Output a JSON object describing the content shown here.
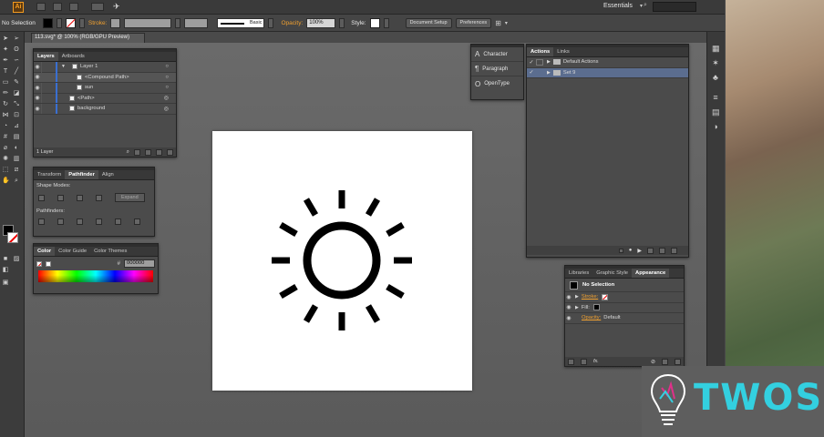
{
  "menubar": {
    "ai_logo": "Ai",
    "workspace": "Essentials"
  },
  "controlbar": {
    "selection_label": "No Selection",
    "stroke_label": "Stroke:",
    "stroke_style": "Basic",
    "opacity_label": "Opacity:",
    "opacity_value": "100%",
    "style_label": "Style:",
    "document_setup": "Document Setup",
    "preferences": "Preferences"
  },
  "document": {
    "tab_title": "113.svg* @ 100% (RGB/GPU Preview)"
  },
  "layers_panel": {
    "tabs": [
      "Layers",
      "Artboards"
    ],
    "rows": [
      {
        "name": "Layer 1"
      },
      {
        "name": "<Compound Path>"
      },
      {
        "name": "sun"
      },
      {
        "name": "<Path>"
      },
      {
        "name": "background"
      }
    ],
    "footer": "1 Layer"
  },
  "pathfinder_panel": {
    "tabs": [
      "Transform",
      "Pathfinder",
      "Align"
    ],
    "shape_modes_label": "Shape Modes:",
    "expand_label": "Expand",
    "pathfinders_label": "Pathfinders:"
  },
  "color_panel": {
    "tabs": [
      "Color",
      "Color Guide",
      "Color Themes"
    ],
    "hex_label": "#",
    "hex_value": "000000"
  },
  "char_panel": {
    "items": [
      "Character",
      "Paragraph",
      "OpenType"
    ]
  },
  "actions_panel": {
    "tabs": [
      "Actions",
      "Links"
    ],
    "rows": [
      {
        "name": "Default Actions"
      },
      {
        "name": "Set 9"
      }
    ]
  },
  "appearance_panel": {
    "tabs": [
      "Libraries",
      "Graphic Style",
      "Appearance"
    ],
    "no_selection": "No Selection",
    "stroke_label": "Stroke:",
    "fill_label": "Fill:",
    "opacity_label": "Opacity:",
    "opacity_value": "Default",
    "fx_label": "fx."
  },
  "watermark": {
    "text": "TWOS"
  },
  "colors": {
    "accent": "#3a6fd0",
    "logo_text": "#33d0e0",
    "orange_label": "#f0a030"
  }
}
